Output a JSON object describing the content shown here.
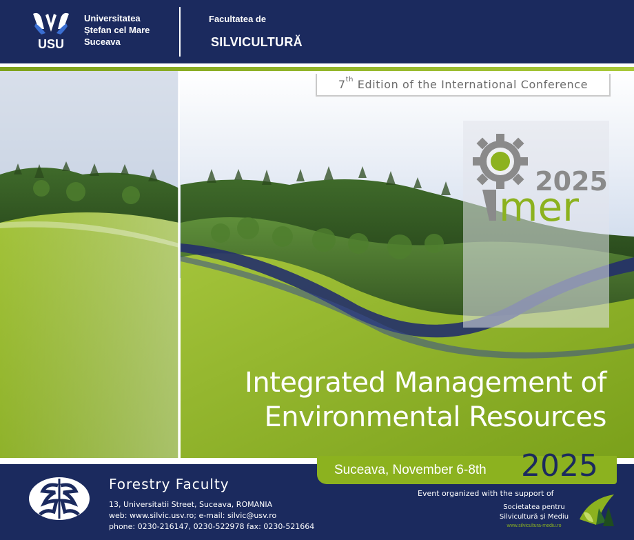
{
  "header": {
    "university_line1": "Universitatea",
    "university_line2": "Ștefan cel Mare",
    "university_line3": "Suceava",
    "logo_text": "USU",
    "faculty_label": "Facultatea de",
    "faculty_name": "SILVICULTURĂ"
  },
  "banner": {
    "edition_num": "7",
    "edition_sup": "th",
    "edition_rest": " Edition of the International Conference",
    "logo_year": "2025",
    "logo_name": "mer",
    "title_line1": "Integrated Management of",
    "title_line2": "Environmental Resources"
  },
  "date_box": {
    "location_date": "Suceava, November 6-8th",
    "year": "2025"
  },
  "footer": {
    "faculty_title": "Forestry Faculty",
    "address": "13, Universitatii Street, Suceava, ROMANIA",
    "web_email": "web: www.silvic.usv.ro; e-mail: silvic@usv.ro",
    "phone_fax": "phone: 0230-216147, 0230-522978  fax: 0230-521664",
    "support_text": "Event organized with the support  of",
    "society_line1": "Societatea pentru",
    "society_line2": "Silvicultură și Mediu",
    "society_url": "www.silvicultura-mediu.ro"
  },
  "colors": {
    "navy": "#1b2a5e",
    "green": "#8cb21f",
    "light_green": "#a9c93a",
    "gray_text": "#6b6b6b"
  },
  "icons": [
    "usv-logo-icon",
    "gear-icon",
    "forestry-faculty-logo-icon",
    "society-logo-icon"
  ]
}
